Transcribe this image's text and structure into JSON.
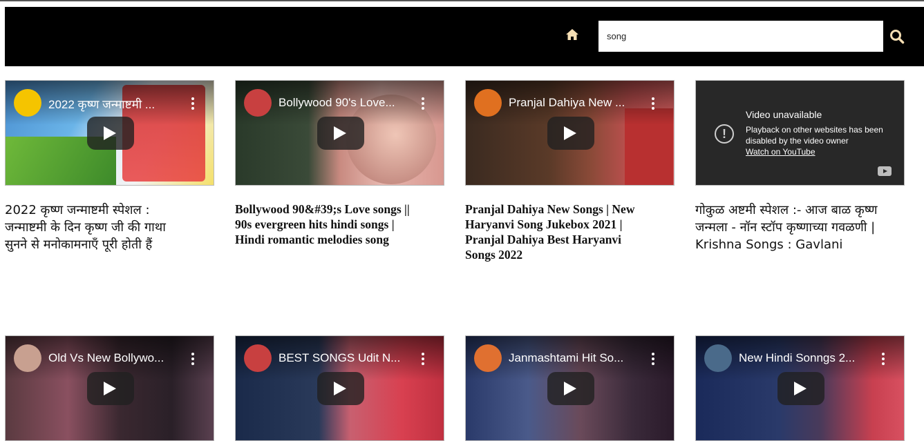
{
  "header": {
    "home_icon": "home-icon",
    "search_value": "song",
    "search_icon": "search-icon",
    "accent_color": "#f5deb3"
  },
  "videos": [
    {
      "thumb_title": "2022 कृष्ण जन्माष्टमी ...",
      "caption": "2022 कृष्ण जन्माष्टमी स्पेशल : जन्माष्टमी के दिन कृष्ण जी की गाथा सुनने से मनोकामनाएँ पूरी होती हैं"
    },
    {
      "thumb_title": "Bollywood 90's Love...",
      "caption": "Bollywood 90&#39;s Love songs || 90s evergreen hits hindi songs | Hindi romantic melodies song"
    },
    {
      "thumb_title": "Pranjal Dahiya New ...",
      "caption": "Pranjal Dahiya New Songs | New Haryanvi Song Jukebox 2021 | Pranjal Dahiya Best Haryanvi Songs 2022"
    },
    {
      "unavailable": true,
      "unavail_title": "Video unavailable",
      "unavail_message": "Playback on other websites has been disabled by the video owner",
      "unavail_link": "Watch on YouTube",
      "caption": "गोकुळ अष्टमी स्पेशल :- आज बाळ कृष्ण जन्मला - नॉन स्टॉप कृष्णाच्या गवळणी | Krishna Songs : Gavlani"
    },
    {
      "thumb_title": "Old Vs New Bollywo..."
    },
    {
      "thumb_title": "BEST SONGS Udit N..."
    },
    {
      "thumb_title": "Janmashtami Hit So..."
    },
    {
      "thumb_title": "New Hindi Sonngs 2..."
    }
  ]
}
